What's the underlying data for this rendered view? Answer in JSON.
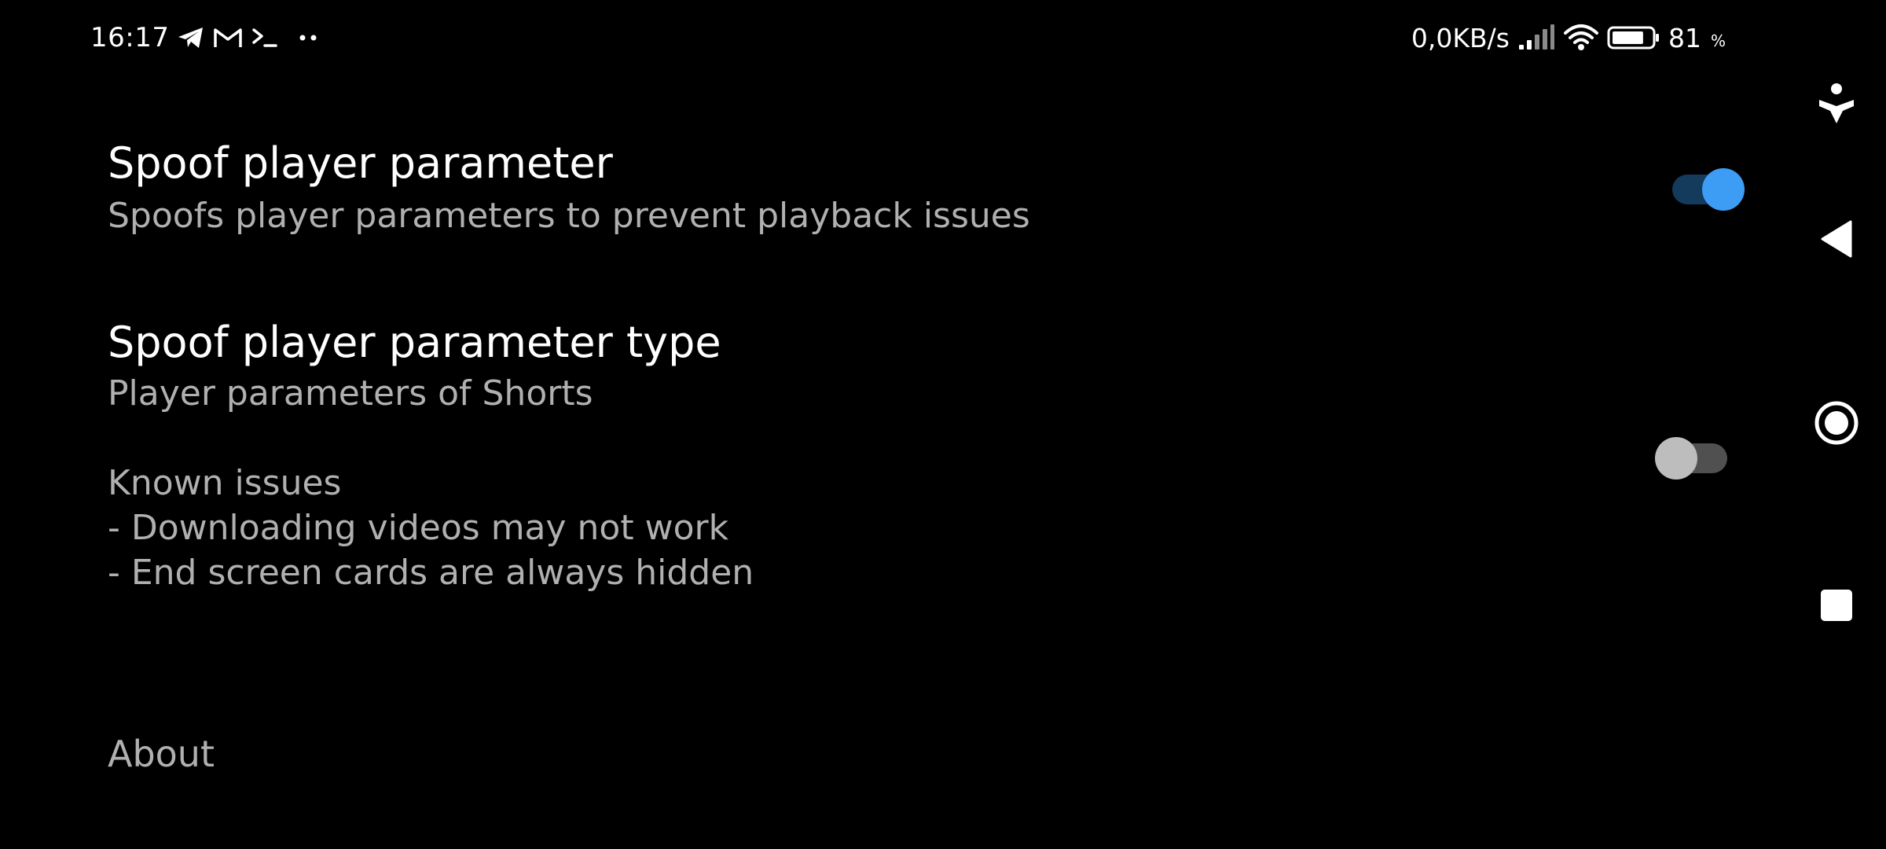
{
  "status_bar": {
    "time": "16:17",
    "net_speed": "0,0KB/s",
    "battery_percent": "81",
    "battery_unit": "%",
    "battery_level": 0.81,
    "left_icons": [
      "telegram-icon",
      "gmail-icon",
      "terminal-icon",
      "more-dots-icon"
    ],
    "right_icons": [
      "signal-icon",
      "wifi-icon",
      "battery-icon"
    ]
  },
  "settings": {
    "spoof_player_parameter": {
      "title": "Spoof player parameter",
      "summary": "Spoofs player parameters to prevent playback issues",
      "enabled": true
    },
    "spoof_player_parameter_type": {
      "title": "Spoof player parameter type",
      "summary": "Player parameters of Shorts\n\nKnown issues\n- Downloading videos may not work\n- End screen cards are always hidden",
      "enabled": false
    },
    "about": {
      "title": "About"
    }
  },
  "nav_bar": {
    "buttons": [
      "accessibility-icon",
      "back-icon",
      "home-icon",
      "recents-icon"
    ]
  },
  "colors": {
    "background": "#000000",
    "title_text": "#ffffff",
    "summary_text": "#b0b0b0",
    "switch_on_thumb": "#3d9df5",
    "switch_on_track": "#143a5c",
    "switch_off_thumb": "#bdbdbd",
    "switch_off_track": "#505050"
  }
}
